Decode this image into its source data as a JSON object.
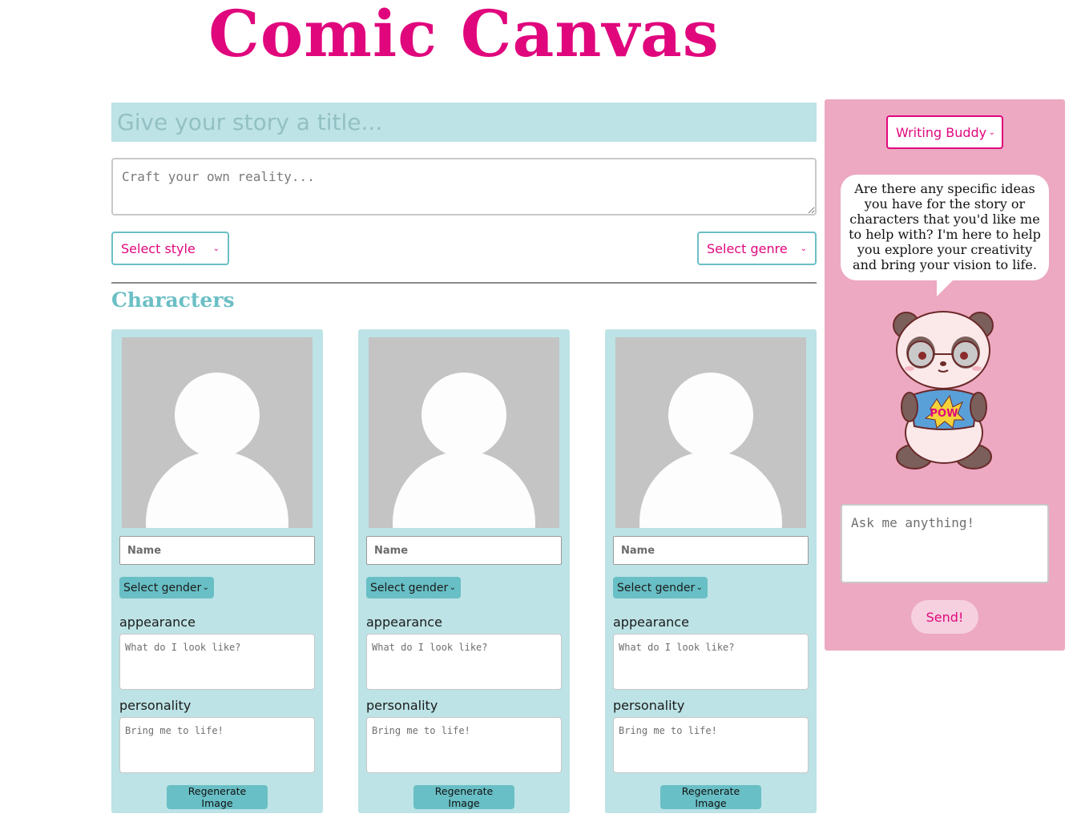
{
  "app": {
    "title": "Comic Canvas"
  },
  "story": {
    "title_placeholder": "Give your story a title...",
    "body_placeholder": "Craft your own reality...",
    "style_select": "Select style",
    "genre_select": "Select genre"
  },
  "characters": {
    "heading": "Characters",
    "cards": [
      {
        "name_placeholder": "Name",
        "gender_select": "Select gender",
        "appearance_label": "appearance",
        "appearance_placeholder": "What do I look like?",
        "personality_label": "personality",
        "personality_placeholder": "Bring me to life!",
        "regenerate_label": "Regenerate Image"
      },
      {
        "name_placeholder": "Name",
        "gender_select": "Select gender",
        "appearance_label": "appearance",
        "appearance_placeholder": "What do I look like?",
        "personality_label": "personality",
        "personality_placeholder": "Bring me to life!",
        "regenerate_label": "Regenerate Image"
      },
      {
        "name_placeholder": "Name",
        "gender_select": "Select gender",
        "appearance_label": "appearance",
        "appearance_placeholder": "What do I look like?",
        "personality_label": "personality",
        "personality_placeholder": "Bring me to life!",
        "regenerate_label": "Regenerate Image"
      }
    ]
  },
  "assistant": {
    "mode_select": "Writing Buddy",
    "message": "Are there any specific ideas you have for the story or characters that you'd like me to help with? I'm here to help you explore your creativity and bring your vision to life.",
    "mascot_icon": "panda-mascot-icon",
    "shirt_text": "POW",
    "input_placeholder": "Ask me anything!",
    "send_label": "Send!"
  },
  "colors": {
    "brand_pink": "#e0077d",
    "teal": "#6bbfc5",
    "light_teal": "#bde3e6",
    "panel_pink": "#eca9c1"
  }
}
